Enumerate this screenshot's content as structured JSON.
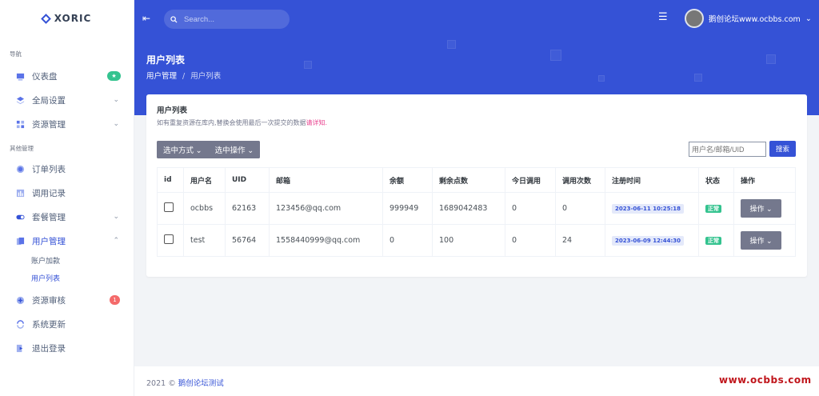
{
  "brand": {
    "logo_text": "XORIC",
    "accent": "#3552d6"
  },
  "sidebar": {
    "section_nav": "导航",
    "section_other": "其他管理",
    "items": [
      {
        "label": "仪表盘",
        "icon": "monitor-icon",
        "badge": "★"
      },
      {
        "label": "全局设置",
        "icon": "layers-icon"
      },
      {
        "label": "资源管理",
        "icon": "grid-icon"
      },
      {
        "label": "订单列表",
        "icon": "circle-icon"
      },
      {
        "label": "调用记录",
        "icon": "bar-chart-icon"
      },
      {
        "label": "套餐管理",
        "icon": "toggle-icon"
      },
      {
        "label": "用户管理",
        "icon": "docs-icon"
      },
      {
        "label": "资源审核",
        "icon": "plus-circle-icon",
        "badge": "1"
      },
      {
        "label": "系统更新",
        "icon": "refresh-icon"
      },
      {
        "label": "退出登录",
        "icon": "logout-icon"
      }
    ],
    "sub_items": [
      "账户加款",
      "用户列表"
    ]
  },
  "topbar": {
    "search_placeholder": "Search...",
    "username": "鹅创论坛www.ocbbs.com"
  },
  "page": {
    "title": "用户列表",
    "breadcrumb_parent": "用户管理",
    "breadcrumb_sep": "/",
    "breadcrumb_current": "用户列表"
  },
  "card": {
    "title": "用户列表",
    "desc": "如有重复资源在库内,替换会使用最后一次提交的数据",
    "desc_link": "请详知.",
    "select_mode": "选中方式",
    "select_action": "选中操作",
    "search_placeholder": "用户名/邮箱/UID",
    "search_button": "搜索"
  },
  "table": {
    "headers": [
      "id",
      "用户名",
      "UID",
      "邮箱",
      "余额",
      "剩余点数",
      "今日调用",
      "调用次数",
      "注册时间",
      "状态",
      "操作"
    ],
    "rows": [
      {
        "username": "ocbbs",
        "uid": "62163",
        "email": "123456@qq.com",
        "balance": "999949",
        "points": "1689042483",
        "today": "0",
        "calls": "0",
        "reg": "2023-06-11 10:25:18",
        "status": "正常",
        "action": "操作"
      },
      {
        "username": "test",
        "uid": "56764",
        "email": "1558440999@qq.com",
        "balance": "0",
        "points": "100",
        "today": "0",
        "calls": "24",
        "reg": "2023-06-09 12:44:30",
        "status": "正常",
        "action": "操作"
      }
    ]
  },
  "footer": {
    "year": "2021 ©",
    "link": "鹅创论坛测试",
    "watermark": "www.ocbbs.com"
  }
}
